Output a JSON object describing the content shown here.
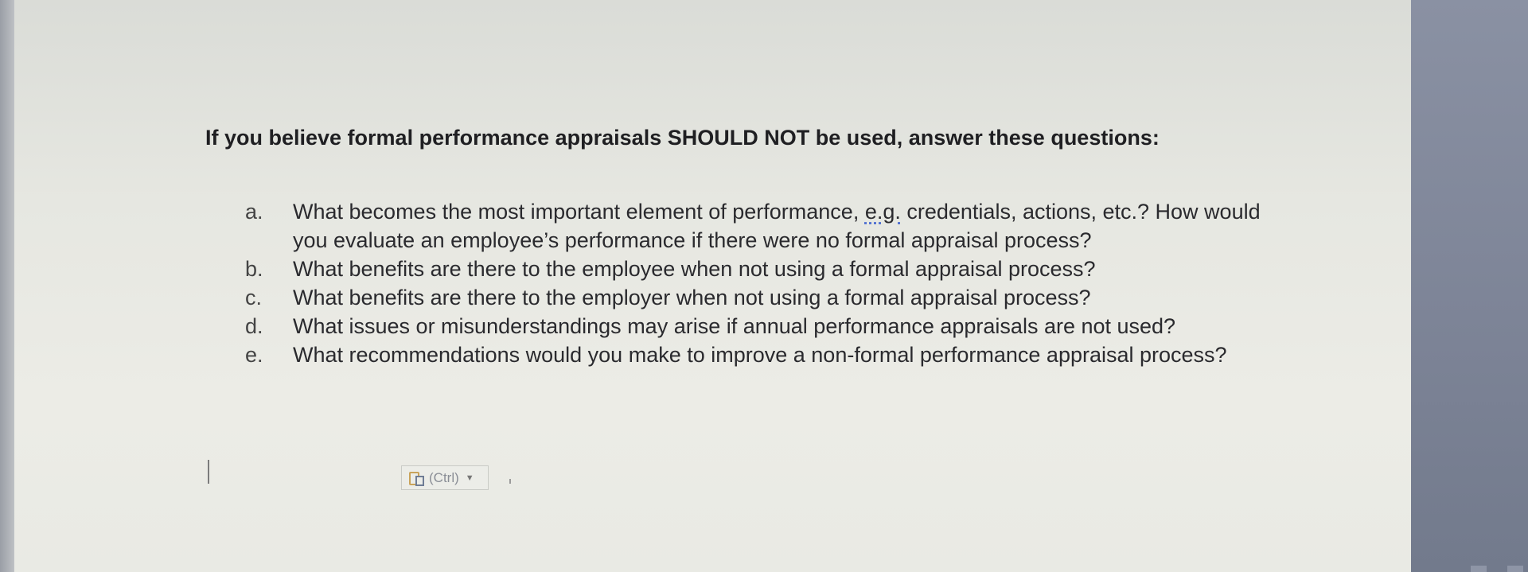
{
  "document": {
    "heading": "If you believe formal performance appraisals SHOULD NOT be used, answer these questions:",
    "questions": [
      {
        "marker": "a.",
        "text_before": "What becomes the most important element of performance, ",
        "abbrev": "e.g.",
        "text_after": " credentials, actions, etc.? How would you evaluate an employee’s performance if there were no formal appraisal process?"
      },
      {
        "marker": "b.",
        "text": "What benefits are there to the employee when not using a formal appraisal process?"
      },
      {
        "marker": "c.",
        "text": "What benefits are there to the employer when not using a formal appraisal process?"
      },
      {
        "marker": "d.",
        "text": "What issues or misunderstandings may arise if annual performance appraisals are not used?"
      },
      {
        "marker": "e.",
        "text": "What recommendations would you make to improve a non-formal performance appraisal process?"
      }
    ]
  },
  "paste_options": {
    "label": "(Ctrl)",
    "icon": "clipboard-paste-icon"
  }
}
